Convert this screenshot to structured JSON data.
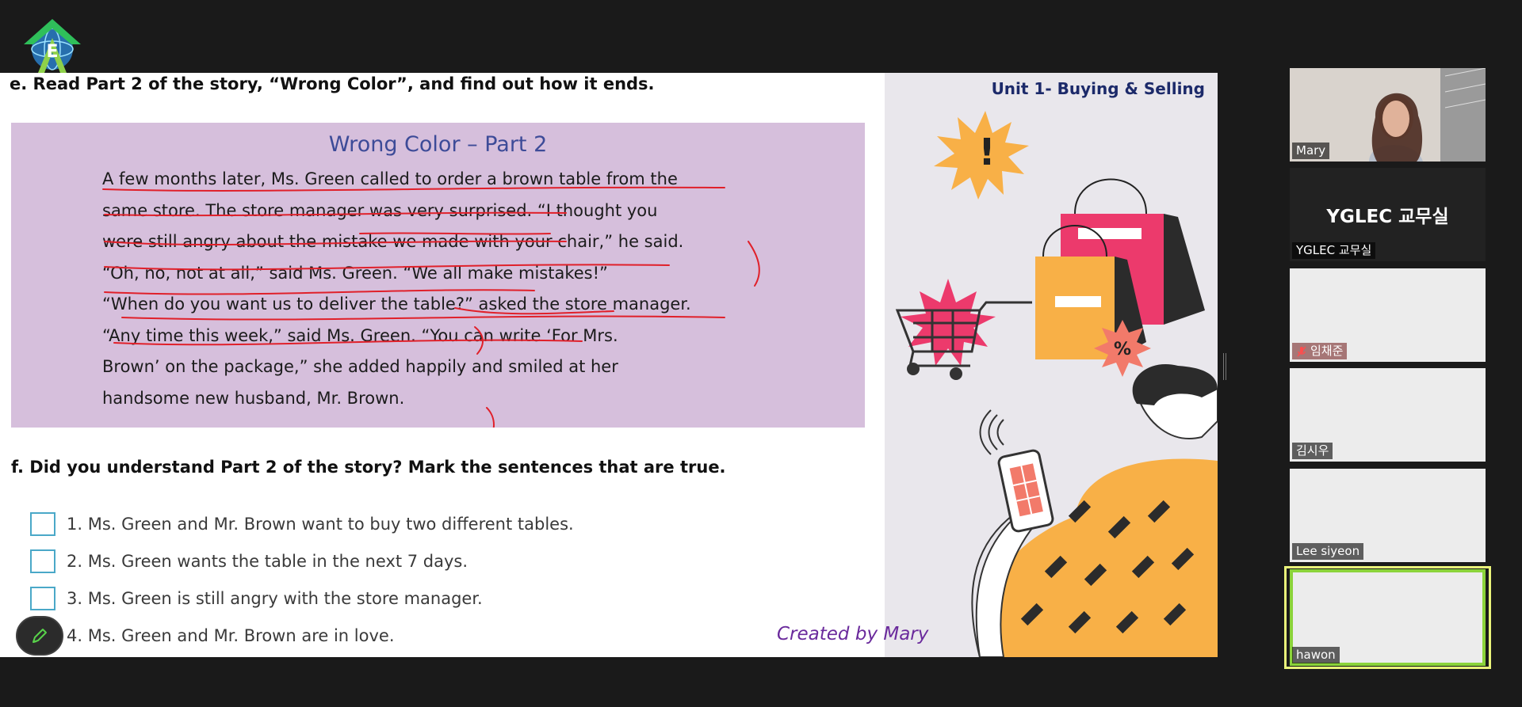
{
  "colors": {
    "slide_bg": "#ffffff",
    "story_box": "#d6bfdc",
    "story_title": "#3d4b98",
    "unit_title": "#1c2a6a",
    "credit": "#6a2a9c",
    "checkbox_border": "#4aa8c8",
    "annotation_red": "#e0202a",
    "active_speaker_border": "#8bd33a"
  },
  "logo": {
    "icon": "academy-globe-logo"
  },
  "slide": {
    "unit_title": "Unit 1- Buying & Selling",
    "instruction_e": "e. Read Part 2 of the story, “Wrong Color”, and find out how it ends.",
    "story": {
      "title": "Wrong Color – Part 2",
      "lines": [
        "A few months later, Ms. Green called to order a brown table from the",
        "same store. The store manager was very surprised. “I thought you",
        "were still angry about the mistake we made with your chair,” he said.",
        "“Oh, no, not at all,” said Ms. Green. “We all make mistakes!”",
        "“When do you want us to deliver the table?” asked the store manager.",
        "“Any time this week,” said Ms. Green. “You can write ‘For Mrs.",
        "Brown’ on the package,” she added happily and smiled at her",
        "handsome new husband, Mr. Brown."
      ]
    },
    "instruction_f": "f. Did you understand Part 2 of the story? Mark the sentences that are true.",
    "questions": [
      {
        "text": "1. Ms. Green and Mr. Brown want to buy two different tables.",
        "checked": false
      },
      {
        "text": "2. Ms. Green wants the table in the next 7 days.",
        "checked": false
      },
      {
        "text": "3. Ms. Green is still angry with the store manager.",
        "checked": false
      },
      {
        "text": "4. Ms. Green and Mr. Brown are in love.",
        "checked": false
      }
    ],
    "illustration_text": {
      "burst": "!",
      "percent": "%"
    },
    "credit": "Created by Mary"
  },
  "toolbar": {
    "pen_icon": "pencil-icon"
  },
  "participants": [
    {
      "name": "Mary",
      "video": true,
      "muted": false
    },
    {
      "name": "YGLEC 교무실",
      "label": "YGLEC 교무실",
      "video": false,
      "muted": false
    },
    {
      "name": "임채준",
      "video": true,
      "muted": true
    },
    {
      "name": "김시우",
      "video": true,
      "muted": false
    },
    {
      "name": "Lee siyeon",
      "video": true,
      "muted": false
    },
    {
      "name": "hawon",
      "video": true,
      "muted": false,
      "active_speaker": true
    }
  ]
}
